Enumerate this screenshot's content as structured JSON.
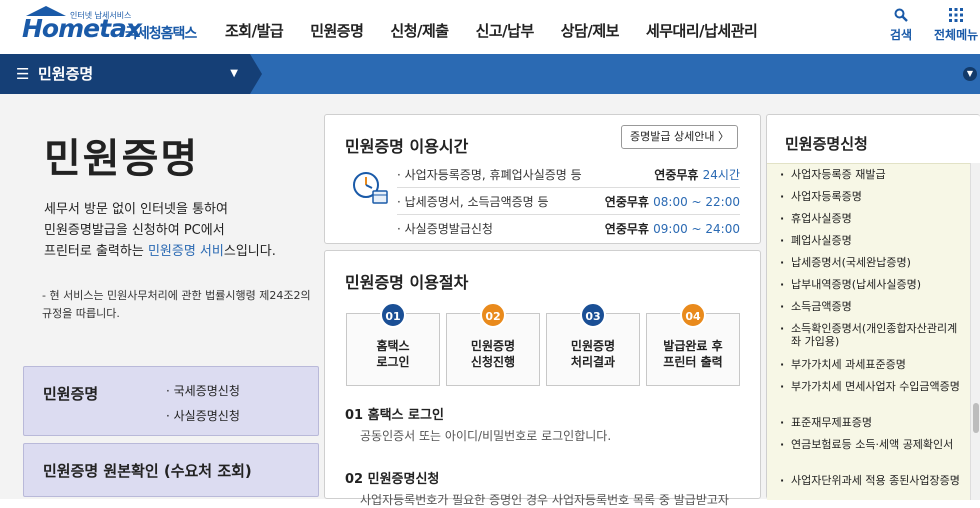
{
  "header": {
    "logo_brand": "Hometax",
    "logo_tagline": "인터넷 납세서비스",
    "logo_korean": "국세청홈택스",
    "menu": [
      "조회/발급",
      "민원증명",
      "신청/제출",
      "신고/납부",
      "상담/제보",
      "세무대리/납세관리"
    ],
    "search_label": "검색",
    "allmenu_label": "전체메뉴"
  },
  "navbar": {
    "current": "민원증명"
  },
  "intro": {
    "title": "민원증명",
    "desc_line1": "세무서 방문 없이 인터넷을 통하여",
    "desc_line2": "민원증명발급을 신청하여 PC에서",
    "desc_line3_pre": "프린터로 출력하는 ",
    "desc_line3_link": "민원증명 서비",
    "desc_line3_post": "스입니다.",
    "note": "- 현 서비스는 민원사무처리에 관한 법률시행령 제24조2의 규정을 따릅니다."
  },
  "left_boxes": {
    "box1_title": "민원증명",
    "box1_item1": "· 국세증명신청",
    "box1_item2": "· 사실증명신청",
    "box2_title": "민원증명 원본확인 (수요처 조회)"
  },
  "hours": {
    "title": "민원증명 이용시간",
    "guide_button": "증명발급 상세안내 〉",
    "rows": [
      {
        "label": "· 사업자등록증명, 휴폐업사실증명 등",
        "val_pre": "연중무휴 ",
        "val_num": "24시간"
      },
      {
        "label": "· 납세증명서, 소득금액증명 등",
        "val_pre": "연중무휴 ",
        "val_num": "08:00 ~ 22:00"
      },
      {
        "label": "· 사실증명발급신청",
        "val_pre": "연중무휴 ",
        "val_num": "09:00 ~ 24:00"
      }
    ]
  },
  "procedure": {
    "title": "민원증명 이용절차",
    "steps": [
      {
        "num": "01",
        "label": "홈택스\n로그인",
        "color": "#1a4f95"
      },
      {
        "num": "02",
        "label": "민원증명\n신청진행",
        "color": "#e98a1c"
      },
      {
        "num": "03",
        "label": "민원증명\n처리결과",
        "color": "#1a4f95"
      },
      {
        "num": "04",
        "label": "발급완료 후\n프린터 출력",
        "color": "#e98a1c"
      }
    ],
    "detail1_title": "01 홈택스 로그인",
    "detail1_desc": "공동인증서 또는 아이디/비밀번호로 로그인합니다.",
    "detail2_title": "02 민원증명신청",
    "detail2_desc": "사업자등록번호가 필요한 증명인 경우 사업자등록번호 목록 중 발급받고자"
  },
  "apply": {
    "title": "민원증명신청",
    "items": [
      "사업자등록증 재발급",
      "사업자등록증명",
      "휴업사실증명",
      "폐업사실증명",
      "납세증명서(국세완납증명)",
      "납부내역증명(납세사실증명)",
      "소득금액증명",
      "소득확인증명서(개인종합자산관리계좌 가입용)",
      "부가가치세 과세표준증명",
      "부가가치세 면세사업자 수입금액증명",
      "표준재무제표증명",
      "연금보험료등 소득·세액 공제확인서",
      "사업자단위과세 적용 종된사업장증명"
    ]
  },
  "colors": {
    "primary": "#2b6ab3",
    "navy": "#153f76",
    "orange": "#e98a1c",
    "lavender": "#dcdcf1"
  }
}
